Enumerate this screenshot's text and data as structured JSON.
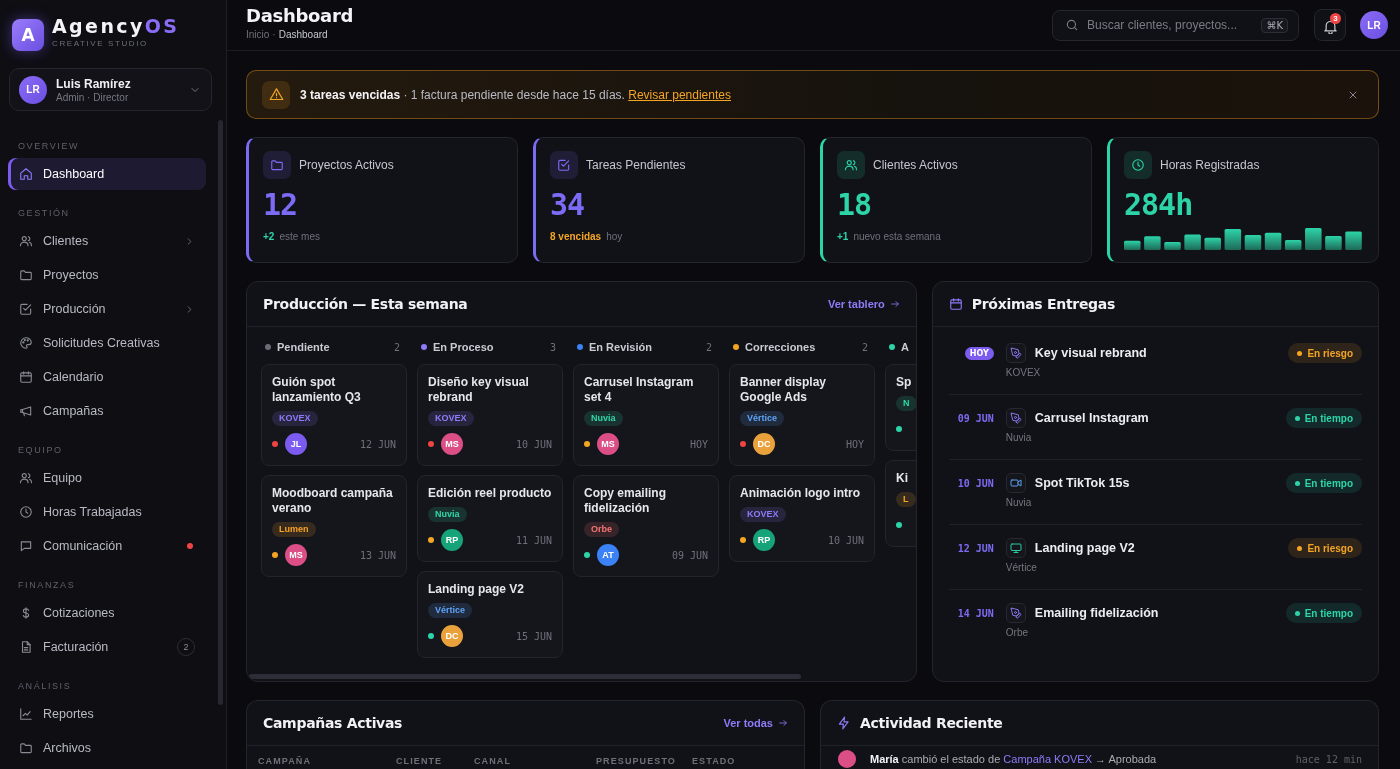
{
  "sidebar": {
    "logo": {
      "letter": "A",
      "name": "Agency",
      "accent": "OS",
      "tagline": "CREATIVE STUDIO"
    },
    "user": {
      "initials": "LR",
      "name": "Luis Ramírez",
      "role": "Admin · Director"
    },
    "sections": [
      {
        "label": "OVERVIEW",
        "items": [
          {
            "label": "Dashboard",
            "selected": true,
            "submenu": false,
            "alert": false
          }
        ]
      },
      {
        "label": "GESTIÓN",
        "items": [
          {
            "label": "Clientes",
            "selected": false,
            "submenu": true,
            "alert": false
          },
          {
            "label": "Proyectos",
            "selected": false,
            "submenu": false,
            "alert": false
          },
          {
            "label": "Producción",
            "selected": false,
            "submenu": true,
            "alert": false
          },
          {
            "label": "Solicitudes Creativas",
            "selected": false,
            "submenu": false,
            "alert": false
          },
          {
            "label": "Calendario",
            "selected": false,
            "submenu": false,
            "alert": false
          },
          {
            "label": "Campañas",
            "selected": false,
            "submenu": false,
            "alert": false
          }
        ]
      },
      {
        "label": "EQUIPO",
        "items": [
          {
            "label": "Equipo",
            "selected": false,
            "submenu": false,
            "alert": false
          },
          {
            "label": "Horas Trabajadas",
            "selected": false,
            "submenu": false,
            "alert": false
          },
          {
            "label": "Comunicación",
            "selected": false,
            "submenu": false,
            "alert": true
          }
        ]
      },
      {
        "label": "FINANZAS",
        "items": [
          {
            "label": "Cotizaciones",
            "selected": false,
            "submenu": false,
            "alert": false
          },
          {
            "label": "Facturación",
            "selected": false,
            "submenu": false,
            "alert": false,
            "badge": "2"
          }
        ]
      },
      {
        "label": "ANÁLISIS",
        "items": [
          {
            "label": "Reportes",
            "selected": false,
            "submenu": false,
            "alert": false
          },
          {
            "label": "Archivos",
            "selected": false,
            "submenu": false,
            "alert": false
          }
        ]
      }
    ]
  },
  "header": {
    "title": "Dashboard",
    "separator": "·",
    "breadcrumb": [
      {
        "label": "Inicio",
        "current": false
      },
      {
        "label": "Dashboard",
        "current": true
      }
    ],
    "search": {
      "placeholder": "Buscar clientes, proyectos...",
      "shortcut": "⌘K"
    },
    "notifications": "3",
    "avatar": "LR"
  },
  "alert": {
    "text": "**3 tareas vencidas** · 1 factura pendiente desde hace 15 días.",
    "link": "Revisar pendientes"
  },
  "stats": [
    {
      "label": "Proyectos Activos",
      "value": "12",
      "color": "#7c6cf5",
      "kind": "trend",
      "delta": {
        "text": "+2",
        "color": "#2dd4a8"
      },
      "note": "este mes"
    },
    {
      "label": "Tareas Pendientes",
      "value": "34",
      "color": "#7c6cf5",
      "kind": "trend",
      "delta": {
        "text": "8 vencidas",
        "color": "#f5a524"
      },
      "note": "hoy"
    },
    {
      "label": "Clientes Activos",
      "value": "18",
      "color": "#2dd4a8",
      "kind": "trend",
      "delta": {
        "text": "+1",
        "color": "#2dd4a8"
      },
      "note": "nuevo esta semana"
    },
    {
      "label": "Horas Registradas",
      "value": "284h",
      "color": "#2dd4a8",
      "kind": "sparkline"
    }
  ],
  "production": {
    "title": "Producción — Esta semana",
    "link": "Ver tablero",
    "columns": [
      {
        "name": "Pendiente",
        "color": "#6b6c76",
        "count": "2",
        "cards": [
          {
            "title": "Guión spot lanzamiento Q3",
            "tag": {
              "label": "KOVEX",
              "color": "#27253d"
            },
            "priority": {
              "color": "#ef4444"
            },
            "assignee": {
              "initials": "JL",
              "color": "#7c5cf0"
            },
            "due": "12 JUN"
          },
          {
            "title": "Moodboard campaña verano",
            "tag": {
              "label": "Lumen",
              "color": "#372b1d"
            },
            "priority": {
              "color": "#f5a524"
            },
            "assignee": {
              "initials": "MS",
              "color": "#db4f86"
            },
            "due": "13 JUN"
          }
        ]
      },
      {
        "name": "En Proceso",
        "color": "#8b7cf8",
        "count": "3",
        "cards": [
          {
            "title": "Diseño key visual rebrand",
            "tag": {
              "label": "KOVEX",
              "color": "#27253d"
            },
            "priority": {
              "color": "#ef4444"
            },
            "assignee": {
              "initials": "MS",
              "color": "#db4f86"
            },
            "due": "10 JUN"
          },
          {
            "title": "Edición reel producto",
            "tag": {
              "label": "Nuvia",
              "color": "#193331"
            },
            "priority": {
              "color": "#f5a524"
            },
            "assignee": {
              "initials": "RP",
              "color": "#16a37a"
            },
            "due": "11 JUN"
          },
          {
            "title": "Landing page V2",
            "tag": {
              "label": "Vértice",
              "color": "#202b3d"
            },
            "priority": {
              "color": "#2dd4a8"
            },
            "assignee": {
              "initials": "DC",
              "color": "#e9a23b"
            },
            "due": "15 JUN"
          }
        ]
      },
      {
        "name": "En Revisión",
        "color": "#3b82f6",
        "count": "2",
        "cards": [
          {
            "title": "Carrusel Instagram set 4",
            "tag": {
              "label": "Nuvia",
              "color": "#193331"
            },
            "priority": {
              "color": "#f5a524"
            },
            "assignee": {
              "initials": "MS",
              "color": "#db4f86"
            },
            "due": "HOY"
          },
          {
            "title": "Copy emailing fidelización",
            "tag": {
              "label": "Orbe",
              "color": "#372429"
            },
            "priority": {
              "color": "#2dd4a8"
            },
            "assignee": {
              "initials": "AT",
              "color": "#3b82f6"
            },
            "due": "09 JUN"
          }
        ]
      },
      {
        "name": "Correcciones",
        "color": "#f5a524",
        "count": "2",
        "cards": [
          {
            "title": "Banner display Google Ads",
            "tag": {
              "label": "Vértice",
              "color": "#202b3d"
            },
            "priority": {
              "color": "#ef4444"
            },
            "assignee": {
              "initials": "DC",
              "color": "#e9a23b"
            },
            "due": "HOY"
          },
          {
            "title": "Animación logo intro",
            "tag": {
              "label": "KOVEX",
              "color": "#27253d"
            },
            "priority": {
              "color": "#f5a524"
            },
            "assignee": {
              "initials": "RP",
              "color": "#16a37a"
            },
            "due": "10 JUN"
          }
        ]
      },
      {
        "name": "A",
        "color": "#2dd4a8",
        "cards": [
          {
            "title": "Sp",
            "tag": {
              "label": "N",
              "color": "#193331"
            },
            "priority": {
              "color": "#2dd4a8"
            }
          },
          {
            "title": "Ki",
            "tag": {
              "label": "L",
              "color": "#372b1d"
            },
            "priority": {
              "color": "#2dd4a8"
            }
          }
        ]
      }
    ]
  },
  "deliveries": {
    "title": "Próximas Entregas",
    "items": [
      {
        "date": "HOY",
        "today": true,
        "title": "Key visual rebrand",
        "client": "KOVEX",
        "status": {
          "label": "En riesgo",
          "kind": "risk"
        }
      },
      {
        "date": "09 JUN",
        "today": false,
        "title": "Carrusel Instagram",
        "client": "Nuvia",
        "status": {
          "label": "En tiempo",
          "kind": "ok"
        }
      },
      {
        "date": "10 JUN",
        "today": false,
        "title": "Spot TikTok 15s",
        "client": "Nuvia",
        "status": {
          "label": "En tiempo",
          "kind": "ok"
        }
      },
      {
        "date": "12 JUN",
        "today": false,
        "title": "Landing page V2",
        "client": "Vértice",
        "status": {
          "label": "En riesgo",
          "kind": "risk"
        }
      },
      {
        "date": "14 JUN",
        "today": false,
        "title": "Emailing fidelización",
        "client": "Orbe",
        "status": {
          "label": "En tiempo",
          "kind": "ok"
        }
      }
    ]
  },
  "campaigns": {
    "title": "Campañas Activas",
    "link": "Ver todas",
    "columns": [
      "CAMPAÑA",
      "CLIENTE",
      "CANAL",
      "PRESUPUESTO",
      "ESTADO"
    ]
  },
  "activity": {
    "title": "Actividad Reciente",
    "items": [
      {
        "color": "#db4f86",
        "text": "**María** cambió el estado de",
        "link": "Campaña KOVEX",
        "result": "→ Aprobada",
        "time": "hace 12 min"
      }
    ]
  }
}
